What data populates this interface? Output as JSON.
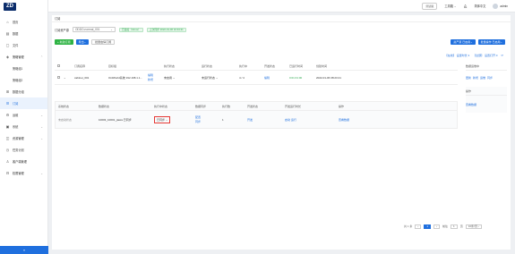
{
  "brand": {
    "logo": "ZD"
  },
  "sidebar": {
    "items": [
      {
        "label": "首页",
        "icon": "home-icon"
      },
      {
        "label": "数据",
        "icon": "database-icon"
      },
      {
        "label": "文件",
        "icon": "file-icon"
      },
      {
        "label": "策略管理",
        "icon": "policy-icon",
        "expanded": true,
        "children": [
          {
            "label": "策略组1"
          },
          {
            "label": "策略组2"
          }
        ]
      },
      {
        "label": "数据分组",
        "icon": "group-icon"
      },
      {
        "label": "订阅",
        "icon": "subscribe-icon",
        "active": true
      },
      {
        "label": "运维",
        "icon": "ops-icon"
      },
      {
        "label": "系统",
        "icon": "system-icon"
      },
      {
        "label": "资源管理",
        "icon": "resource-icon"
      },
      {
        "label": "任务计划",
        "icon": "schedule-icon"
      },
      {
        "label": "客户端管理",
        "icon": "client-icon"
      },
      {
        "label": "权限管理",
        "icon": "permission-icon"
      }
    ],
    "collapse_label": "«"
  },
  "topbar": {
    "env_label": "测试版",
    "menu_label": "工具箱",
    "notification_icon": "bell-icon",
    "lang": "简体中文",
    "user": "admin"
  },
  "main": {
    "title": "订阅",
    "source_label": "订阅资产源",
    "source_value": "ODDO-normal_001",
    "status_tag": "已连接（10ms）",
    "time_tag": "上次同步 2022-01-06 16:43:21",
    "btn_create": "+ 新建订阅",
    "btn_export": "导出",
    "btn_batch": "批量启停订阅",
    "btn_right1": "资产源 已启用",
    "btn_right2": "批量操作 已启用"
  },
  "filterbar": {
    "a": "【在线】 设置时长 3",
    "b": "【全部】 设置打开 0"
  },
  "table": {
    "headers": [
      "订阅名称",
      "目标组",
      "执行状态",
      "运行状态",
      "执行中",
      "开发状态",
      "已运行时间",
      "创建时间"
    ],
    "rows": [
      {
        "name": "cabinet_001",
        "target": "OrdWorld系统 192.168.1.1...",
        "actions": [
          "编辑",
          "新增"
        ],
        "exec_state": "未启用",
        "run_state": "未运行状态",
        "count": "4 / 4",
        "dev_state": "编辑",
        "runtime": "0:01:01:00",
        "created": "2022-01-06 08:23:41"
      }
    ]
  },
  "subtable": {
    "headers": [
      "系统状态",
      "数据状态",
      "执行中状态",
      "数据同步",
      "执行数",
      "开发状态",
      "开发运行时长",
      "操作"
    ],
    "rows": [
      {
        "sys_state": "未启动状态",
        "data_state": "10003_10001_jiawa",
        "data_badge": "已同步",
        "exec_state": "已同步",
        "sync": [
          "配置",
          "同步"
        ],
        "exec_count": "1",
        "dev_state": "开发",
        "dev_time": "启动 运行",
        "op": "查看数据"
      }
    ]
  },
  "right_panel": {
    "header": "数据运维中",
    "row_actions": [
      "更新",
      "新增",
      "运维",
      "同步"
    ],
    "sub_header": "操作",
    "sub_action": "查看数据"
  },
  "pager": {
    "total": "共 1 条",
    "prev": "‹",
    "page": "1",
    "next": "›",
    "goto_label": "前往",
    "goto_value": "1",
    "page_unit": "页",
    "size": "10条/页"
  }
}
